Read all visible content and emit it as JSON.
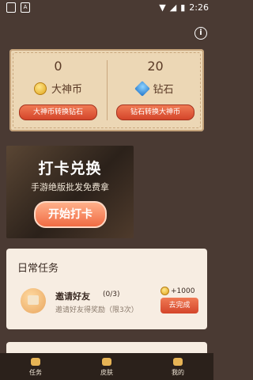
{
  "status": {
    "time": "2:26",
    "left_icons": [
      "A"
    ]
  },
  "currency": {
    "left": {
      "value": "0",
      "name": "大神币",
      "button": "大神币转换钻石"
    },
    "right": {
      "value": "20",
      "name": "钻石",
      "button": "钻石转换大神币"
    }
  },
  "checkin": {
    "title": "打卡兑换",
    "subtitle": "手游绝版批发免费拿",
    "button": "开始打卡"
  },
  "tasks": {
    "title": "日常任务",
    "items": [
      {
        "name": "邀请好友",
        "count": "(0/3)",
        "desc": "邀请好友得奖励（限3次）",
        "reward": "+1000",
        "button": "去完成"
      }
    ]
  },
  "navbar": {
    "items": [
      "任务",
      "皮肤",
      "我的"
    ]
  }
}
